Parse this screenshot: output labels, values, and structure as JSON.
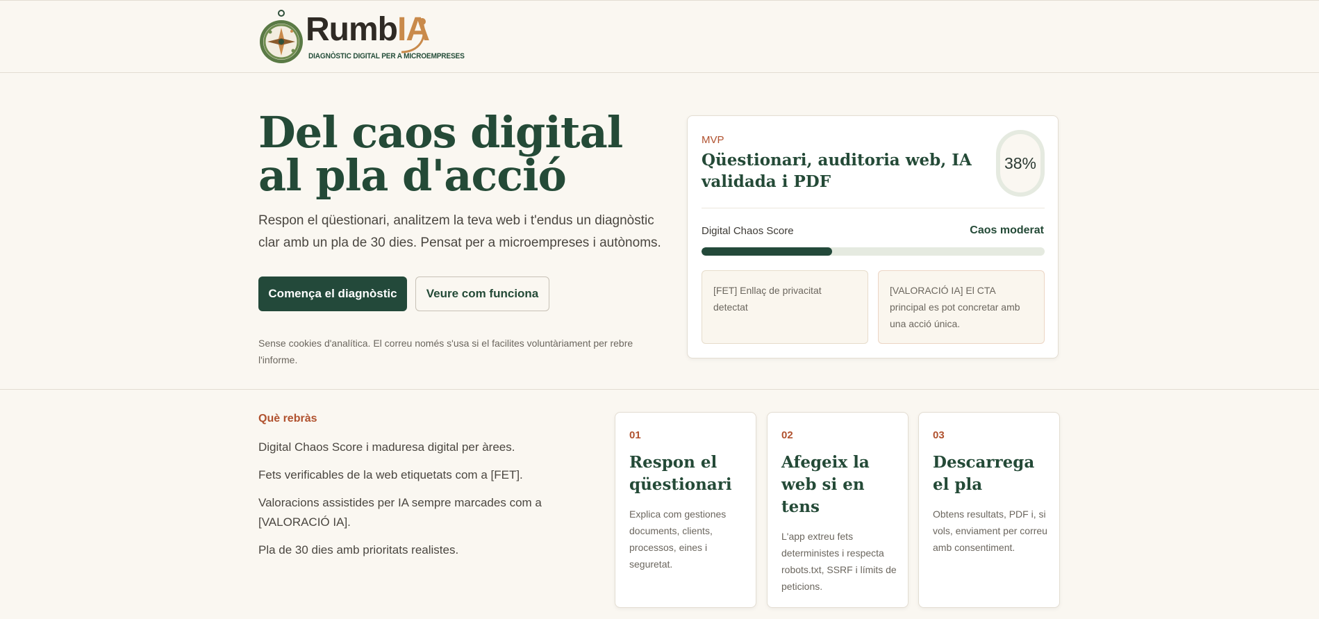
{
  "header": {
    "brand_name_main": "Rumb",
    "brand_name_accent": "IA",
    "tagline": "DIAGNÒSTIC DIGITAL PER A MICROEMPRESES",
    "logo_icon": "compass-icon"
  },
  "hero": {
    "title": "Del caos digital al pla d'acció",
    "subtitle": "Respon el qüestionari, analitzem la teva web i t'endus un diagnòstic clar amb un pla de 30 dies. Pensat per a microempreses i autònoms.",
    "primary_button": "Comença el diagnòstic",
    "secondary_button": "Veure com funciona",
    "privacy_note": "Sense cookies d'analítica. El correu només s'usa si el facilites voluntàriament per rebre l'informe."
  },
  "mvp_card": {
    "eyebrow": "MVP",
    "title": "Qüestionari, auditoria web, IA validada i PDF",
    "percent_label": "38%",
    "score_label": "Digital Chaos Score",
    "score_status": "Caos moderat",
    "progress_fraction": 0.38,
    "notes": [
      "[FET] Enllaç de privacitat detectat",
      "[VALORACIÓ IA] El CTA principal es pot concretar amb una acció única."
    ]
  },
  "features": {
    "title": "Què rebràs",
    "items": [
      "Digital Chaos Score i maduresa digital per àrees.",
      "Fets verificables de la web etiquetats com a [FET].",
      "Valoracions assistides per IA sempre marcades com a [VALORACIÓ IA].",
      "Pla de 30 dies amb prioritats realistes."
    ]
  },
  "steps": [
    {
      "number": "01",
      "title": "Respon el qüestionari",
      "body": "Explica com gestiones documents, clients, processos, eines i seguretat."
    },
    {
      "number": "02",
      "title": "Afegeix la web si en tens",
      "body": "L'app extreu fets deterministes i respecta robots.txt, SSRF i límits de peticions."
    },
    {
      "number": "03",
      "title": "Descarrega el pla",
      "body": "Obtens resultats, PDF i, si vols, enviament per correu amb consentiment."
    }
  ],
  "colors": {
    "brand_green": "#23493a",
    "accent_rust": "#b0512e",
    "accent_gold": "#c98a4b",
    "background": "#faf7f1"
  }
}
